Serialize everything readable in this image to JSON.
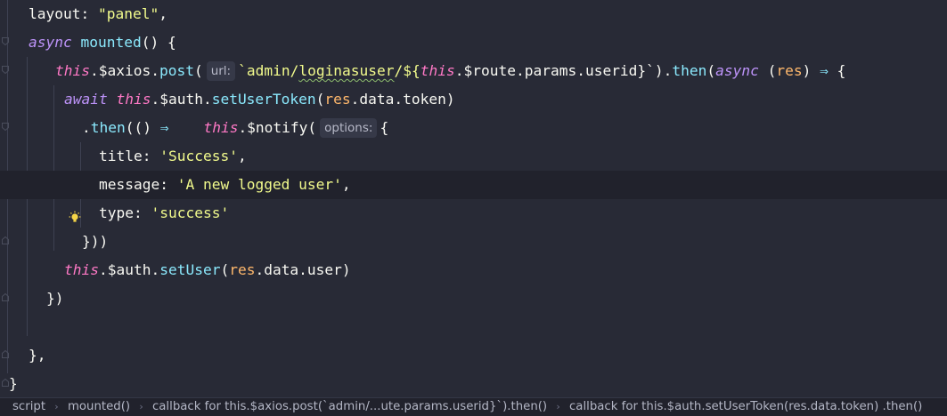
{
  "editor": {
    "lines": [
      {
        "parts": [
          "layout",
          ": ",
          "\"panel\"",
          ","
        ]
      },
      {
        "parts": [
          "async",
          " ",
          "mounted",
          "() {"
        ]
      },
      {
        "parts": [
          "this",
          ".$axios.",
          "post",
          "(",
          "url:",
          "`admin/",
          "loginasuser",
          "/${",
          "this",
          ".$route.params.userid}`",
          ").",
          "then",
          "(",
          "async",
          " (",
          "res",
          ") ",
          "⇒",
          " {"
        ]
      },
      {
        "parts": [
          "await",
          " ",
          "this",
          ".$auth.",
          "setUserToken",
          "(",
          "res",
          ".data.token)"
        ]
      },
      {
        "parts": [
          ".",
          "then",
          "(() ",
          "⇒",
          "    ",
          "this",
          ".$notify(",
          "options:",
          "{"
        ]
      },
      {
        "parts": [
          "title",
          ": ",
          "'Success'",
          ","
        ]
      },
      {
        "parts": [
          "message",
          ": ",
          "'A new logged user'",
          ","
        ]
      },
      {
        "parts": [
          "type",
          ": ",
          "'success'"
        ]
      },
      {
        "parts": [
          "}))"
        ]
      },
      {
        "parts": [
          "this",
          ".$auth.",
          "setUser",
          "(",
          "res",
          ".data.user)"
        ]
      },
      {
        "parts": [
          "})"
        ]
      },
      {
        "parts": [
          ""
        ]
      },
      {
        "parts": [
          "},"
        ]
      },
      {
        "parts": [
          "}"
        ]
      }
    ]
  },
  "statusbar": {
    "breadcrumbs": [
      "script",
      "mounted()",
      "callback for this.$axios.post(`admin/...ute.params.userid}`).then()",
      "callback for this.$auth.setUserToken(res.data.token) .then()"
    ]
  },
  "icons": {
    "intention": "lightbulb-icon",
    "fold": "fold-marker-icon"
  },
  "colors": {
    "background": "#282a36",
    "current_line": "#21222c",
    "keyword": "#ff79c6",
    "async_keyword": "#bd93f9",
    "function": "#8be9fd",
    "string": "#f1fa8c",
    "parameter": "#ffb86c",
    "hint_background": "#363948"
  }
}
